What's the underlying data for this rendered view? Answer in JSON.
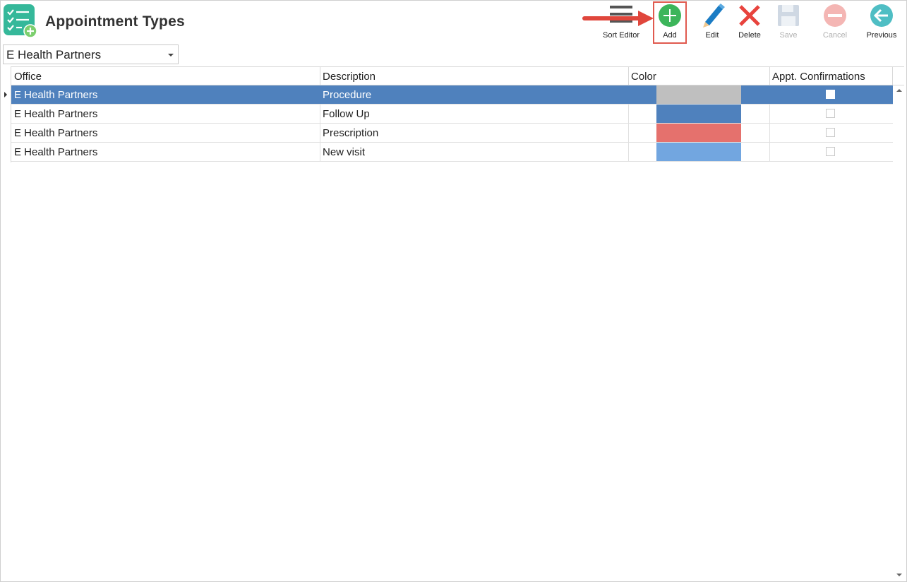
{
  "page": {
    "title": "Appointment Types"
  },
  "toolbar": {
    "sort_editor": "Sort Editor",
    "add": "Add",
    "edit": "Edit",
    "delete": "Delete",
    "save": "Save",
    "cancel": "Cancel",
    "previous": "Previous"
  },
  "office_filter": {
    "selected": "E Health Partners"
  },
  "grid": {
    "columns": [
      "Office",
      "Description",
      "Color",
      "Appt. Confirmations"
    ],
    "rows": [
      {
        "office": "E Health Partners",
        "description": "Procedure",
        "color": "#bfbfbf",
        "confirmations": false,
        "selected": true
      },
      {
        "office": "E Health Partners",
        "description": "Follow Up",
        "color": "#4f81bd",
        "confirmations": false,
        "selected": false
      },
      {
        "office": "E Health Partners",
        "description": "Prescription",
        "color": "#e5716d",
        "confirmations": false,
        "selected": false
      },
      {
        "office": "E Health Partners",
        "description": "New visit",
        "color": "#72a6e0",
        "confirmations": false,
        "selected": false
      }
    ]
  },
  "colors": {
    "add_green": "#3cb55a",
    "delete_red": "#e8433d",
    "edit_blue": "#1b7cc4",
    "previous_teal": "#4fbec4",
    "cancel_pink": "#f4b6b4",
    "highlight": "#e05a4f",
    "selection": "#4f81bd",
    "logo_teal": "#35b89a"
  }
}
